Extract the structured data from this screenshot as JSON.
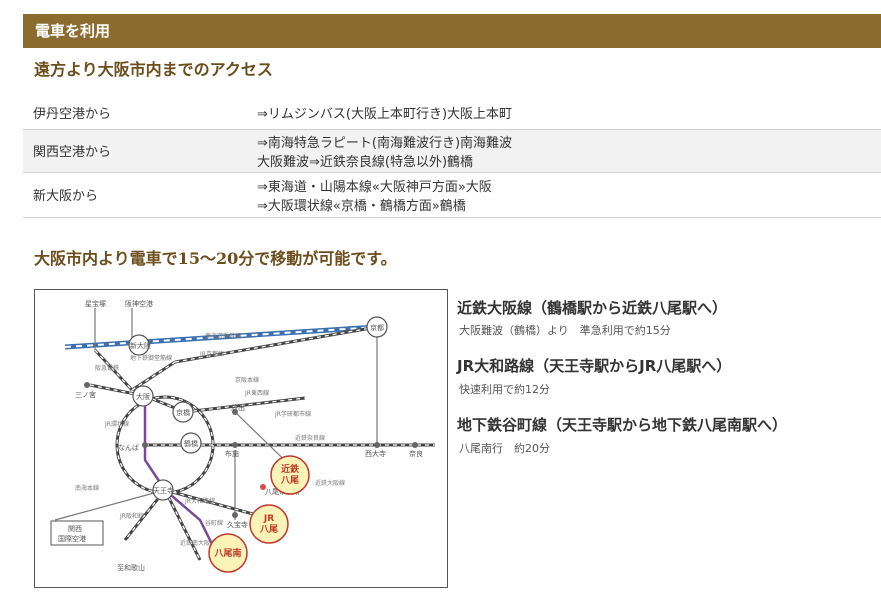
{
  "section_header": "電車を利用",
  "heading_far": "遠方より大阪市内までのアクセス",
  "access_rows": [
    {
      "from": "伊丹空港から",
      "lines": [
        "⇒リムジンバス(大阪上本町行き)大阪上本町"
      ]
    },
    {
      "from": "関西空港から",
      "lines": [
        "⇒南海特急ラピート(南海難波行き)南海難波",
        "大阪難波⇒近鉄奈良線(特急以外)鶴橋"
      ]
    },
    {
      "from": "新大阪から",
      "lines": [
        "⇒東海道・山陽本線«大阪神戸方面»大阪",
        "⇒大阪環状線«京橋・鶴橋方面»鶴橋"
      ]
    }
  ],
  "heading_city": "大阪市内より電車で15～20分で移動が可能です。",
  "routes": [
    {
      "title": "近鉄大阪線（鶴橋駅から近鉄八尾駅へ）",
      "sub": "大阪難波（鶴橋）より　準急利用で約15分"
    },
    {
      "title": "JR大和路線（天王寺駅からJR八尾駅へ）",
      "sub": "快速利用で約12分"
    },
    {
      "title": "地下鉄谷町線（天王寺駅から地下鉄八尾南駅へ）",
      "sub": "八尾南行　約20分"
    }
  ],
  "map": {
    "stations": {
      "kyoto": "京都",
      "shin_osaka": "新大阪",
      "osaka": "大阪",
      "kyobashi": "京橋",
      "sannomiya": "三ノ宮",
      "namba": "なんば",
      "tsuruhashi": "鶴橋",
      "fuse": "布施",
      "nishi_daiji": "西大寺",
      "nara": "奈良",
      "tennoji": "天王寺",
      "kyuhoji": "久宝寺",
      "kansai_airport_1": "関西",
      "kansai_airport_2": "国際空港",
      "hoshida": "星宝塚",
      "itami": "阪神空港",
      "wakayama": "至和歌山",
      "hanna": "放出",
      "takaida": "高井田"
    },
    "lines": {
      "tokaido": "東海道新幹線",
      "jr_kyoto": "JR京都線",
      "keihan": "京阪本線",
      "kintetsu_nara": "近鉄奈良線",
      "jr_osaka_kanjo": "JR環状線",
      "jr_yamatoji": "JR大和路線",
      "kintetsu_osaka": "近鉄大阪線",
      "tanimachi": "谷町線",
      "hankyu": "阪急電鉄",
      "jr_gakkentoshi": "JR学研都市線",
      "nankai": "南海本線",
      "hanwa": "JR阪和線",
      "midosuji": "地下鉄御堂筋線",
      "kintetsu_minami": "近鉄南大阪線",
      "jr_tozai": "JR東西線",
      "yao_city_hall": "八尾市役所"
    },
    "badges": {
      "kintetsu_yao_1": "近鉄",
      "kintetsu_yao_2": "八尾",
      "jr_yao_1": "JR",
      "jr_yao_2": "八尾",
      "yao_minami": "八尾南"
    },
    "colors": {
      "badge_fill": "#fbf3b8",
      "badge_stroke": "#c0392b",
      "badge_text": "#c0392b",
      "shinkansen": "#3a6fb0",
      "tanimachi": "#7a4a9a"
    }
  }
}
